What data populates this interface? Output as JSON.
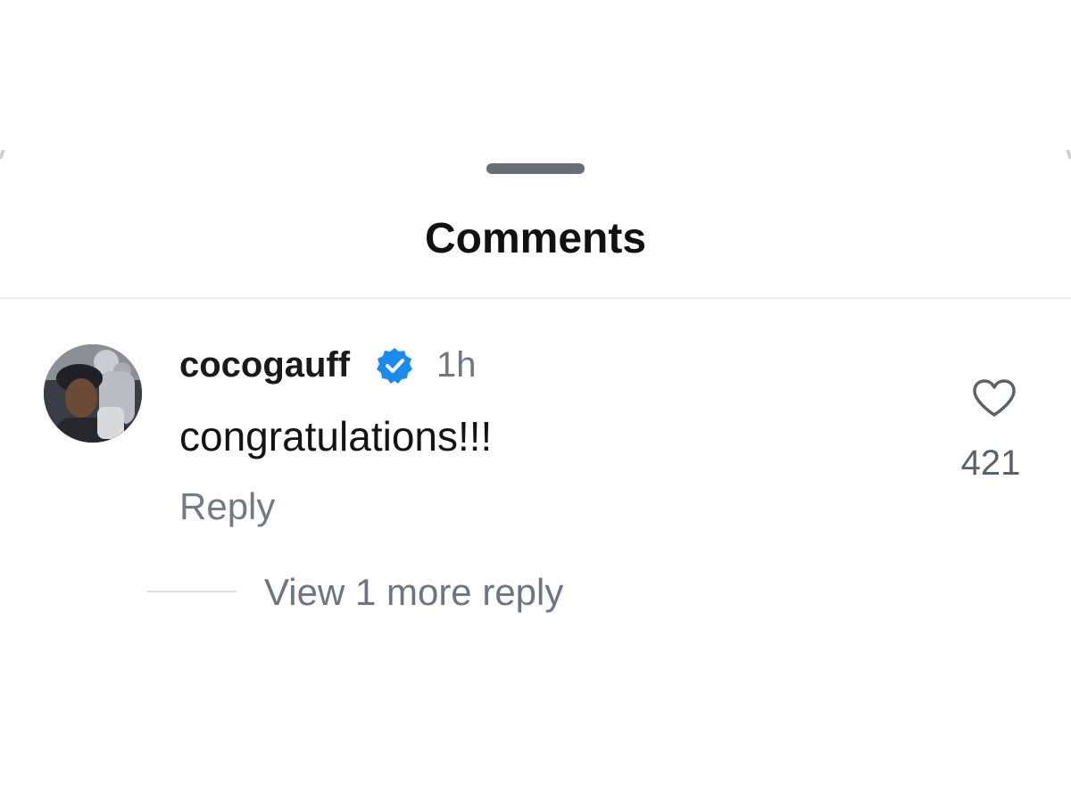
{
  "sheet": {
    "title": "Comments"
  },
  "comment": {
    "username": "cocogauff",
    "verified": true,
    "time": "1h",
    "text": "congratulations!!!",
    "reply_label": "Reply",
    "like_count": "421",
    "view_replies_label": "View 1 more reply"
  },
  "icons": {
    "drag_handle": "drag-handle",
    "avatar": "avatar",
    "verified": "verified-badge-icon",
    "like": "heart-outline-icon"
  },
  "colors": {
    "verified_blue": "#1a8cf0",
    "secondary_text": "#737a84",
    "handle": "#6a6f76"
  }
}
